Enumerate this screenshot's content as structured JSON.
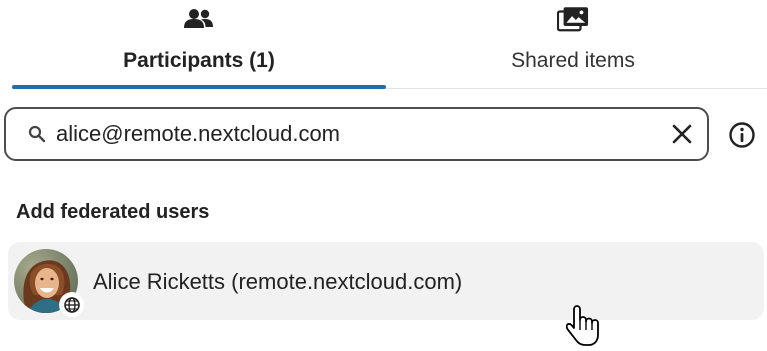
{
  "tabs": {
    "participants": {
      "label": "Participants (1)",
      "icon": "people-icon",
      "active": true
    },
    "shared": {
      "label": "Shared items",
      "icon": "photo-gallery-icon",
      "active": false
    }
  },
  "search": {
    "value": "alice@remote.nextcloud.com",
    "placeholder": "Search or add participants",
    "clear_icon": "close-icon",
    "info_icon": "info-icon"
  },
  "section": {
    "heading": "Add federated users"
  },
  "results": [
    {
      "label": "Alice Ricketts (remote.nextcloud.com)",
      "avatar_icon": "avatar",
      "badge_icon": "globe-icon"
    }
  ],
  "colors": {
    "accent": "#1a6fb3",
    "row_background": "#f2f2f2",
    "text": "#222222"
  },
  "cursor": "hand-pointer-icon"
}
